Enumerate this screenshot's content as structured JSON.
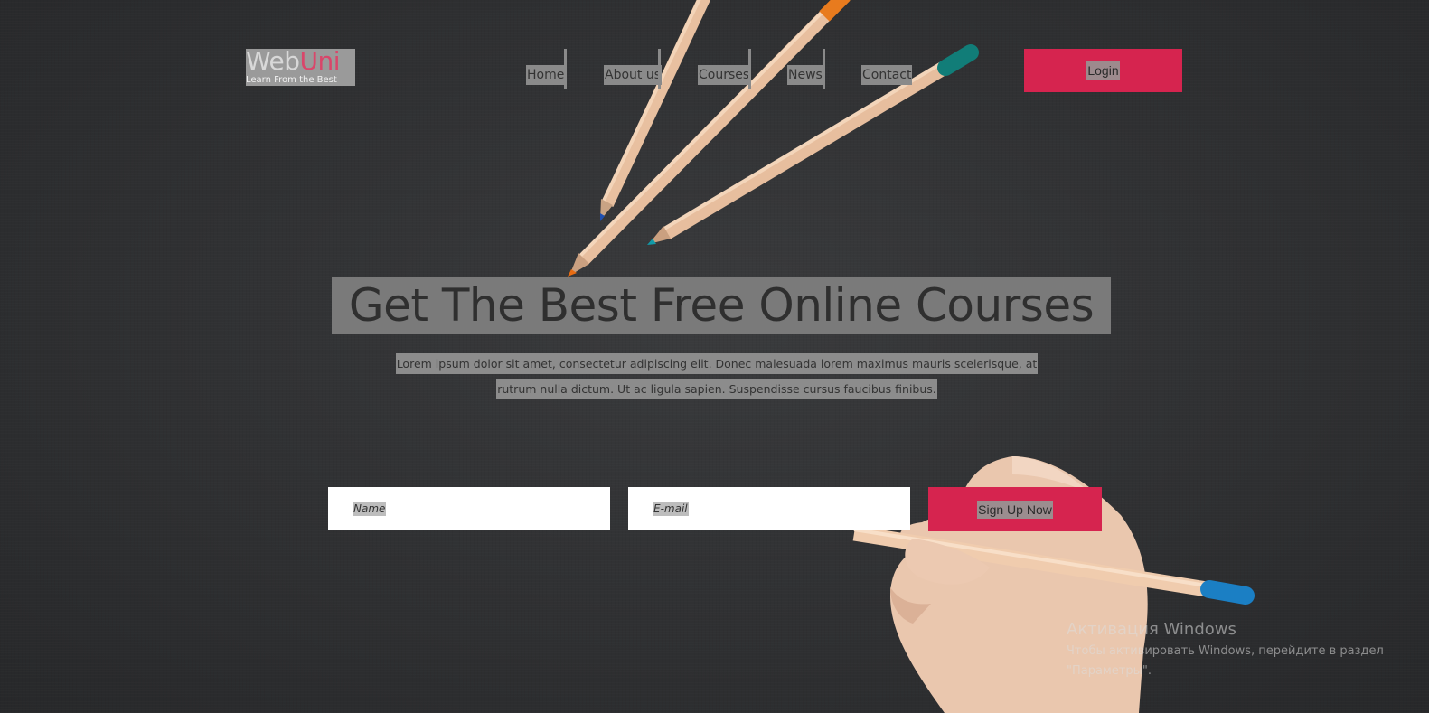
{
  "logo": {
    "brand": "Web",
    "brand_accent": "Uni",
    "tagline": "Learn From the Best"
  },
  "nav": {
    "items": [
      "Home",
      "About us",
      "Courses",
      "News",
      "Contact"
    ]
  },
  "login": {
    "label": "Login"
  },
  "hero": {
    "title": "Get The Best Free Online Courses",
    "description": "Lorem ipsum dolor sit amet, consectetur adipiscing elit. Donec malesuada lorem maximus mauris scelerisque, at rutrum nulla dictum. Ut ac ligula sapien. Suspendisse cursus faucibus finibus."
  },
  "form": {
    "name_placeholder": "Name",
    "email_placeholder": "E-mail",
    "submit_label": "Sign Up Now"
  },
  "watermark": {
    "line1": "Активация Windows",
    "line2": "Чтобы активировать Windows, перейдите в раздел",
    "line3": "\"Параметры\"."
  },
  "colors": {
    "accent": "#d6244f",
    "background": "#313234"
  }
}
